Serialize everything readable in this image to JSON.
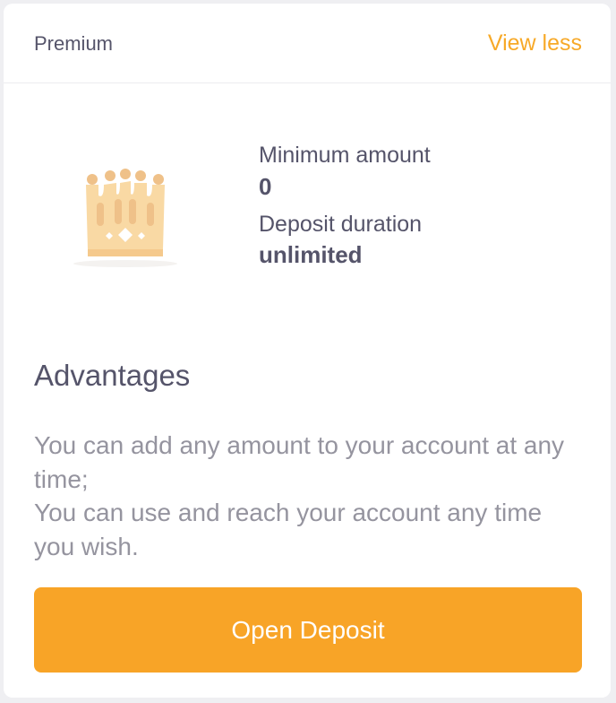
{
  "header": {
    "title": "Premium",
    "toggle_label": "View less"
  },
  "plan": {
    "icon": "crown-icon",
    "min_amount_label": "Minimum amount",
    "min_amount_value": "0",
    "duration_label": "Deposit duration",
    "duration_value": "unlimited"
  },
  "advantages": {
    "title": "Advantages",
    "lines": [
      "You can add any amount to your account at any time;",
      "You can use and reach your account any time you wish."
    ]
  },
  "cta": {
    "label": "Open Deposit"
  },
  "colors": {
    "accent": "#f8a427",
    "text": "#55546a",
    "muted": "#95949f",
    "crown": "#f9d9a4"
  }
}
